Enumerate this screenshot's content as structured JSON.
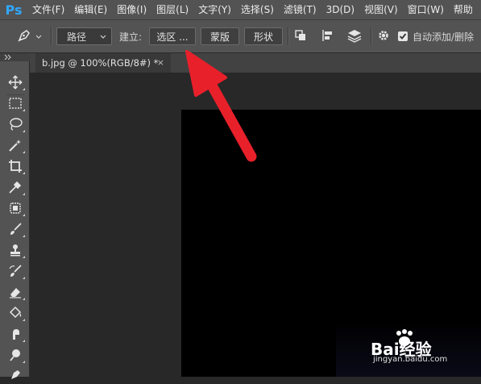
{
  "menubar": {
    "logo": "Ps",
    "items": [
      "文件(F)",
      "编辑(E)",
      "图像(I)",
      "图层(L)",
      "文字(Y)",
      "选择(S)",
      "滤镜(T)",
      "3D(D)",
      "视图(V)",
      "窗口(W)",
      "帮助"
    ]
  },
  "options": {
    "mode_value": "路径",
    "make_label": "建立:",
    "selection_button": "选区 ...",
    "mask_button": "蒙版",
    "shape_button": "形状",
    "auto_add_delete_label": "自动添加/删除",
    "auto_add_delete_checked": true
  },
  "document": {
    "tab_title": "b.jpg @ 100%(RGB/8#) *",
    "close_glyph": "×"
  },
  "annotation": {
    "arrow_color": "#e8202a"
  },
  "watermark": {
    "brand": "Bai经验",
    "url": "jingyan.baidu.com"
  },
  "colors": {
    "menubar_bg": "#535353",
    "canvas_bg": "#000000",
    "ps_blue": "#31a8ff"
  }
}
